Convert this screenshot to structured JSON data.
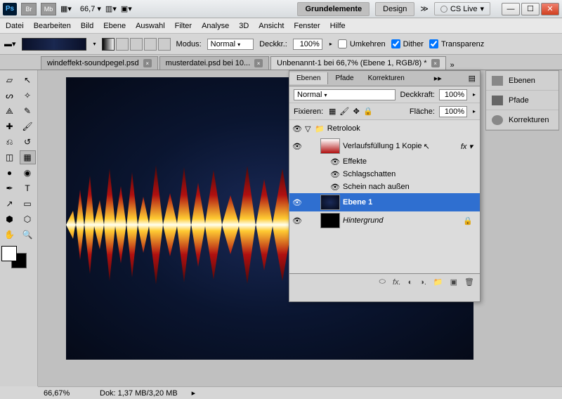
{
  "titlebar": {
    "app_icon": "Ps",
    "br": "Br",
    "mb": "Mb",
    "zoom": "66,7",
    "ws_active": "Grundelemente",
    "ws_design": "Design",
    "cslive": "CS Live"
  },
  "menu": [
    "Datei",
    "Bearbeiten",
    "Bild",
    "Ebene",
    "Auswahl",
    "Filter",
    "Analyse",
    "3D",
    "Ansicht",
    "Fenster",
    "Hilfe"
  ],
  "options": {
    "mode_label": "Modus:",
    "mode_value": "Normal",
    "opacity_label": "Deckkr.:",
    "opacity_value": "100%",
    "cb_reverse": "Umkehren",
    "cb_dither": "Dither",
    "cb_transparency": "Transparenz"
  },
  "tabs": [
    {
      "label": "windeffekt-soundpegel.psd"
    },
    {
      "label": "musterdatei.psd bei 10..."
    },
    {
      "label": "Unbenannt-1 bei 66,7% (Ebene 1, RGB/8) *"
    }
  ],
  "layers_panel": {
    "tabs": [
      "Ebenen",
      "Pfade",
      "Korrekturen"
    ],
    "blend": "Normal",
    "opacity_label": "Deckkraft:",
    "opacity": "100%",
    "lock_label": "Fixieren:",
    "fill_label": "Fläche:",
    "fill": "100%",
    "group": "Retrolook",
    "layer_gradient": "Verlaufsfüllung 1 Kopie",
    "effects_label": "Effekte",
    "fx1": "Schlagschatten",
    "fx2": "Schein nach außen",
    "layer_selected": "Ebene 1",
    "layer_bg": "Hintergrund"
  },
  "dock": {
    "ebenen": "Ebenen",
    "pfade": "Pfade",
    "korrekturen": "Korrekturen"
  },
  "status": {
    "zoom": "66,67%",
    "doc": "Dok: 1,37 MB/3,20 MB"
  }
}
